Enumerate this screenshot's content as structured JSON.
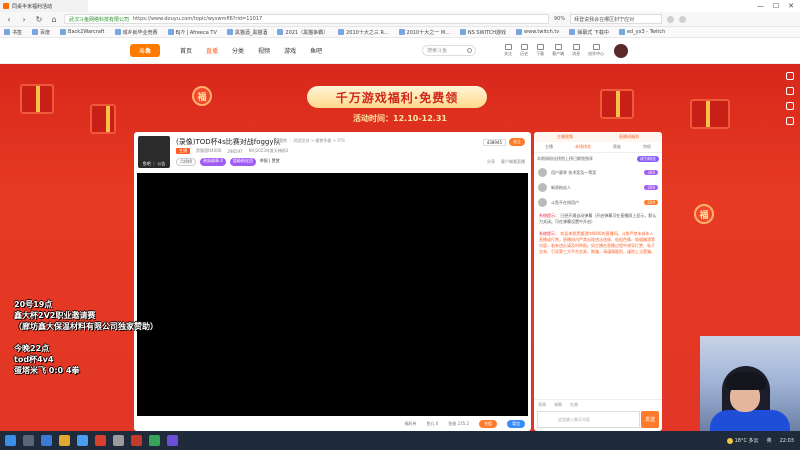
{
  "browser": {
    "tab_title": "同桌半米福利活动",
    "window_controls": [
      "—",
      "☐",
      "✕"
    ],
    "secure_label": "武汉斗鱼网络科技有限公司",
    "url": "https://www.douyu.com/topic/wyswmfl6?rid=11017",
    "zoom": "90%",
    "search_placeholder": "拜登说我会在哪区封宁应对"
  },
  "bookmarks": [
    {
      "label": "书签"
    },
    {
      "label": "百度"
    },
    {
      "label": "Back2Warcraft"
    },
    {
      "label": "城乡就毕业竞赛"
    },
    {
      "label": "BJ가 | Afreeca TV"
    },
    {
      "label": "黑猫酒_黑猫酒"
    },
    {
      "label": "2021（黑猫争霸）"
    },
    {
      "label": "2010十大之三 R..."
    },
    {
      "label": "2010十大之一 M..."
    },
    {
      "label": "NS SWITCH游戏"
    },
    {
      "label": "www.twitch.tv"
    },
    {
      "label": "弹幕式 下载中"
    },
    {
      "label": "ed_yx3 - Twitch"
    }
  ],
  "site": {
    "logo": "斗鱼",
    "nav": [
      "首页",
      "直播",
      "分类",
      "视频",
      "游戏",
      "鱼吧"
    ],
    "nav_active": 1,
    "search_placeholder": "搜索斗鱼",
    "user_tools": [
      "关注",
      "历史",
      "下载",
      "客户端",
      "消息",
      "创作中心"
    ]
  },
  "banner": {
    "title": "千万游戏福利·免费领",
    "date": "活动时间：12.10-12.31",
    "coin_char": "福"
  },
  "room": {
    "title": "(录像)TOD杯4s比赛对战foggy队",
    "category": "魔兽 ｜ 网游竞技 > 魔兽争霸 > RTS",
    "level_badge": "主播",
    "anchor_name": "黑猫酒tt4000",
    "fans": "298597",
    "tag_room": "NV|2023年度天梯前2",
    "avatar_label": "鱼吧 ｜ 公告",
    "rank_tag": "月榜榜",
    "fan_tag": "贵族勋章 4",
    "fan_tag2": "超级粉丝团",
    "report": "举报 | 赞赏",
    "follow_count": "438945",
    "follow_btn": "关注",
    "share": "分享",
    "client": "客户端看直播",
    "bottom": [
      "福利券",
      "鱼丸 0",
      "鱼翅 235.2"
    ],
    "bottom_btn1": "充值",
    "bottom_btn2": "背包"
  },
  "chat": {
    "header": [
      "主播视频",
      "直播间福利"
    ],
    "tabs": [
      "主播",
      "本场排名",
      "贵族",
      "特权"
    ],
    "note": "本期周粉丝榜首上榜已解锁独享",
    "note_btn": "成为粉丝",
    "ranks": [
      {
        "name": "用户赛季 技术奖及一等奖",
        "badge": "300"
      },
      {
        "name": "新晋粉丝人",
        "badge": "200"
      },
      {
        "name": "斗鱼不在线用户",
        "badge": "200"
      }
    ],
    "notice1_label": "系统提示：",
    "notice1": "已经开通自动弹幕（开启弹幕可在直播屏上显示，默认为关闭。可在弹幕设置中开启）",
    "notice2_label": "系统提示：",
    "notice2": "欢迎来到黑猫酒tt4000的直播间。斗鱼严禁未成年人直播或打赏，直播间内严禁出现违法违规、低俗色情、吸烟酗酒等内容，若有违反请及时举报。如主播在直播过程中诱导打赏、私下交易、引导第三方平台交易、欺骗，请谨慎甄别，谨防上当受骗。",
    "tools": [
      "表情",
      "弹幕",
      "礼物"
    ],
    "input_placeholder": "这里输入聊天内容",
    "send": "发送"
  },
  "overlay_lines": [
    "20号19点",
    "鑫大杯2V2职业邀请赛",
    "（廊坊鑫大保温材料有限公司独家赞助）",
    "",
    "今晚22点",
    "tod杯4v4",
    "蛋塔米飞 0:0 4拳"
  ],
  "taskbar": {
    "weather": "18°C 多云",
    "time": "22:03",
    "lang": "英"
  }
}
